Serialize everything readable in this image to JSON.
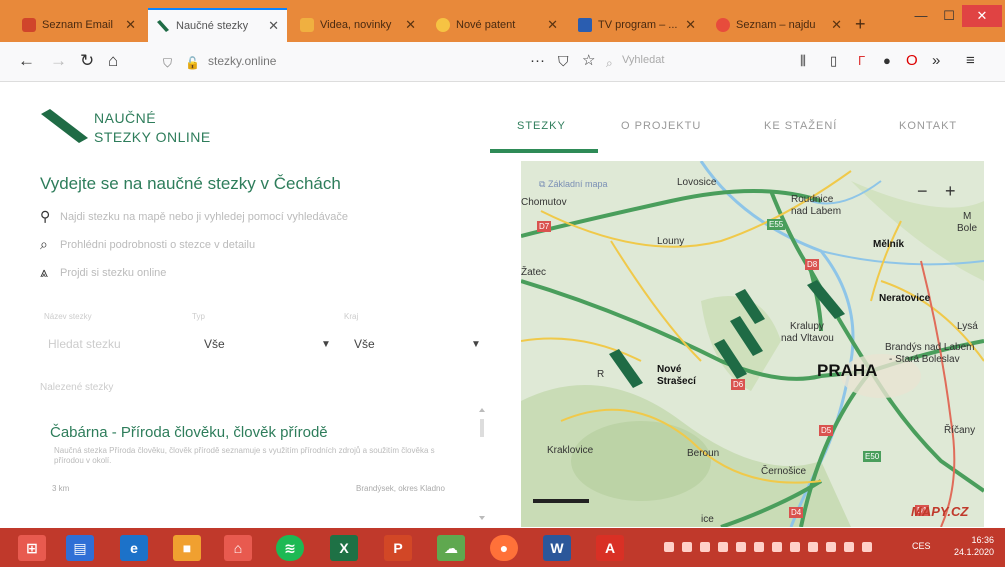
{
  "browser": {
    "tabs": [
      {
        "label": "Seznam Email",
        "active": false
      },
      {
        "label": "Naučné stezky",
        "active": true
      },
      {
        "label": "Videa, novinky",
        "active": false
      },
      {
        "label": "Nové patent",
        "active": false
      },
      {
        "label": "TV program – ...",
        "active": false
      },
      {
        "label": "Seznam – najdu",
        "active": false
      }
    ],
    "url": "stezky.online",
    "search_placeholder": "Vyhledat"
  },
  "site": {
    "logo_line1": "NAUČNÉ",
    "logo_line2": "STEZKY ONLINE",
    "nav": [
      "STEZKY",
      "O PROJEKTU",
      "KE STAŽENÍ",
      "KONTAKT"
    ],
    "headline": "Vydejte se na naučné stezky v Čechách",
    "hints": [
      "Najdi stezku na mapě nebo ji vyhledej pomocí vyhledávače",
      "Prohlédni podrobnosti o stezce v detailu",
      "Projdi si stezku online"
    ],
    "filters": {
      "search_label": "Název stezky",
      "search_placeholder": "Hledat stezku",
      "type_label": "Typ",
      "type_value": "Vše",
      "region_label": "Kraj",
      "region_value": "Vše"
    },
    "results_label": "Nalezené stezky",
    "result": {
      "title": "Čabárna - Příroda člověku, člověk přírodě",
      "desc": "Naučná stezka Příroda člověku, člověk přírodě seznamuje s využitím přírodních zdrojů a soužitím člověka s přírodou v okolí.",
      "length": "3 km",
      "location": "Brandýsek, okres Kladno"
    }
  },
  "map": {
    "layer": "Základní mapa",
    "labels": {
      "chomutov": "Chomutov",
      "lovosice": "Lovosice",
      "roudnice": "Roudnice",
      "nad_labem": "nad Labem",
      "louny": "Louny",
      "zatec": "Žatec",
      "melnik": "Mělník",
      "neratovice": "Neratovice",
      "kralupy": "Kralupy",
      "nad_vltavou": "nad Vltavou",
      "lysa": "Lysá",
      "bole": "Bole",
      "m": "M",
      "brandys": "Brandýs nad Labem",
      "stara_boleslav": "- Stará Boleslav",
      "nove": "Nové",
      "strasec": "Strašecí",
      "r": "R",
      "praha": "PRAHA",
      "kraklovice": "Kraklovice",
      "beroun": "Beroun",
      "ricany": "Říčany",
      "cernosice": "Černošice",
      "ice": "ice"
    },
    "roads": {
      "d7": "D7",
      "d8": "D8",
      "d6": "D6",
      "d5": "D5",
      "d1": "D1",
      "d4": "D4",
      "e55": "E55",
      "e50": "E50"
    },
    "brand": "MAPY.CZ"
  },
  "taskbar": {
    "lang": "CES",
    "time": "16:36",
    "date": "24.1.2020"
  },
  "colors": {
    "accent": "#2e7d5b",
    "tabbar": "#e8893a",
    "taskbar": "#c0392b"
  }
}
